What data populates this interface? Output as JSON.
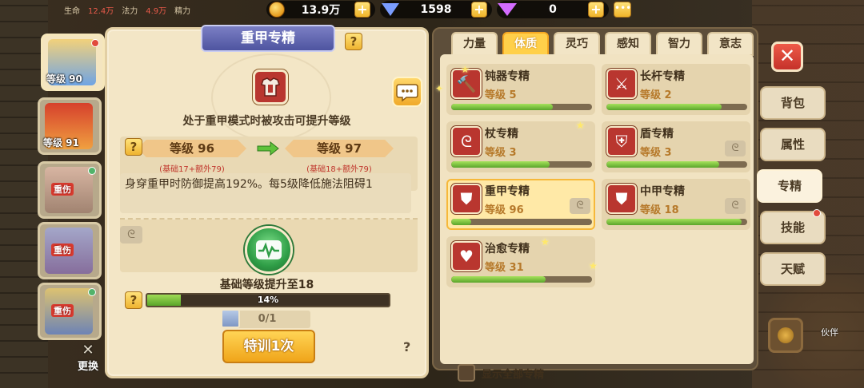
{
  "top_stats": {
    "hp_label": "生命",
    "hp_value": "12.4万",
    "mp_label": "法力",
    "mp_value": "4.9万",
    "sp_label": "精力"
  },
  "currency": {
    "gold": "13.9万",
    "diamond": "1598",
    "purple_gem": "0"
  },
  "characters": [
    {
      "level": "等级 90",
      "status": ""
    },
    {
      "level": "等级 91",
      "status": ""
    },
    {
      "level": "",
      "status": "重伤"
    },
    {
      "level": "",
      "status": "重伤"
    },
    {
      "level": "",
      "status": "重伤"
    }
  ],
  "swap_label": "更换",
  "detail": {
    "title": "重甲专精",
    "help": "?",
    "condition": "处于重甲模式时被攻击可提升等级",
    "current_level": "等级 96",
    "next_level": "等级 97",
    "current_breakdown": "(基础17+额外79)",
    "next_breakdown": "(基础18+额外79)",
    "effect_text": "身穿重甲时防御提高192%。每5级降低施法阻碍1",
    "next_reward": "基础等级提升至18",
    "progress_percent": 14,
    "progress_text": "14%",
    "item_count": "0/1",
    "train_button": "特训1次",
    "footer_help": "?"
  },
  "tabs": [
    "力量",
    "体质",
    "灵巧",
    "感知",
    "智力",
    "意志"
  ],
  "active_tab": "体质",
  "skills": [
    {
      "name": "钝器专精",
      "level": "等级 5",
      "progress": 0.72,
      "icon": "hammer-icon",
      "glyph": "🔨",
      "has_swirl": false
    },
    {
      "name": "长杆专精",
      "level": "等级 2",
      "progress": 0.82,
      "icon": "polearm-icon",
      "glyph": "⚔",
      "has_swirl": false
    },
    {
      "name": "杖专精",
      "level": "等级 3",
      "progress": 0.7,
      "icon": "staff-icon",
      "glyph": "ᘓ",
      "has_swirl": false
    },
    {
      "name": "盾专精",
      "level": "等级 3",
      "progress": 0.8,
      "icon": "shield-icon",
      "glyph": "⛨",
      "has_swirl": true
    },
    {
      "name": "重甲专精",
      "level": "等级 96",
      "progress": 0.14,
      "icon": "heavy-armor-icon",
      "glyph": "⛊",
      "has_swirl": true
    },
    {
      "name": "中甲专精",
      "level": "等级 18",
      "progress": 0.96,
      "icon": "medium-armor-icon",
      "glyph": "⛊",
      "has_swirl": true
    },
    {
      "name": "治愈专精",
      "level": "等级 31",
      "progress": 0.67,
      "icon": "healing-icon",
      "glyph": "♥",
      "has_swirl": false
    }
  ],
  "show_all_label": "显示全部专精",
  "side_nav": [
    "背包",
    "属性",
    "专精",
    "技能",
    "天赋"
  ],
  "active_side": "专精",
  "partner_label": "伙伴",
  "colors": {
    "accent": "#ffd04a",
    "skill_icon_bg": "#b9362f",
    "progress_green": "#5aa52a",
    "injured_red": "#d83a2e"
  }
}
